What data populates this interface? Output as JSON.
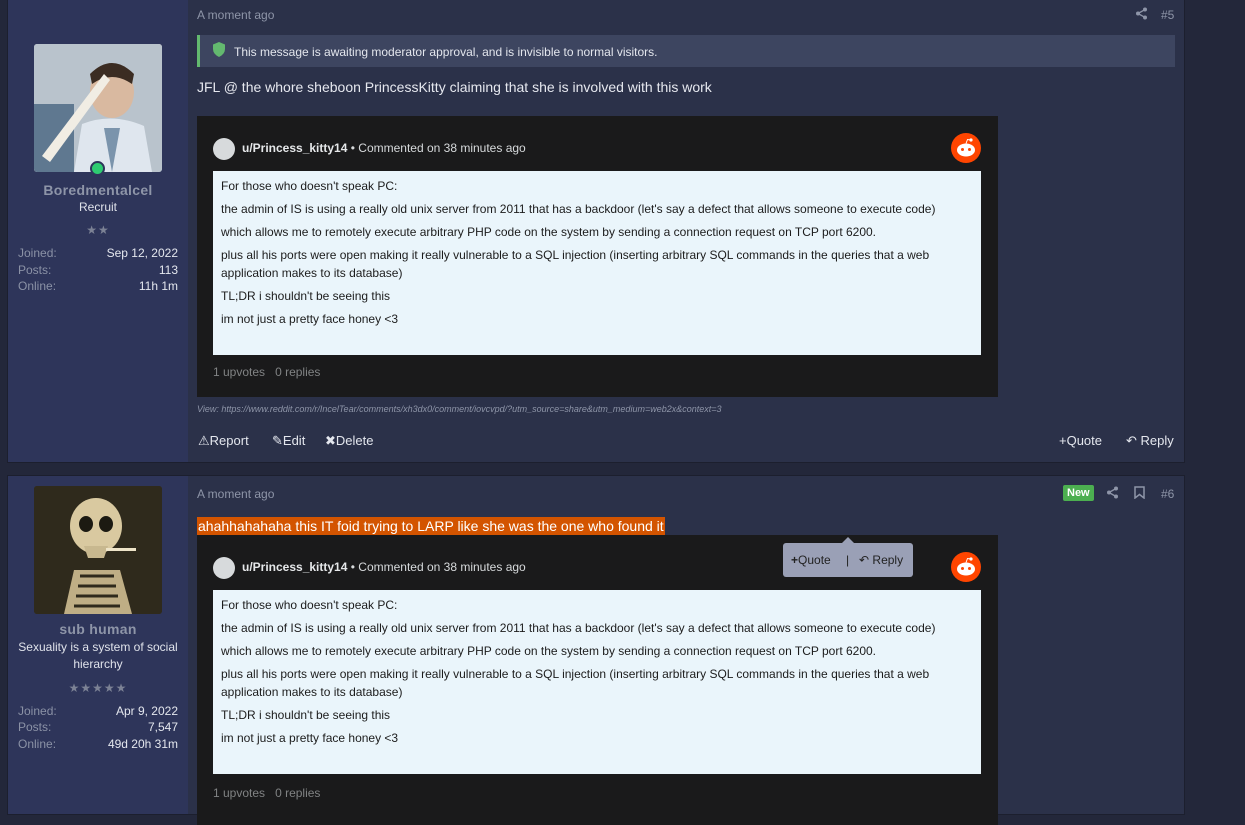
{
  "posts": [
    {
      "time": "A moment ago",
      "number": "#5",
      "user": {
        "name": "Boredmentalcel",
        "title": "Recruit",
        "stars": "★★",
        "joined_label": "Joined:",
        "joined": "Sep 12, 2022",
        "posts_label": "Posts:",
        "posts": "113",
        "online_label": "Online:",
        "online": "11h 1m"
      },
      "notice": "This message is awaiting moderator approval, and is invisible to normal visitors.",
      "message": "JFL @ the whore sheboon PrincessKitty claiming that she is involved with this work",
      "embed": {
        "author": "u/Princess_kitty14",
        "commented": "Commented on 38 minutes ago",
        "lines": [
          "For those who doesn't speak PC:",
          "the admin of IS is using a really old unix server from 2011 that has a backdoor (let's say a defect that allows someone to execute code)",
          "which allows me to remotely execute arbitrary PHP code on the system by sending a connection request on TCP port 6200.",
          "plus all his ports were open making it really vulnerable to a SQL injection (inserting arbitrary SQL commands in the queries that a web application makes to its database)",
          "TL;DR i shouldn't be seeing this",
          "im not just a pretty face honey <3"
        ],
        "upvotes": "1 upvotes",
        "replies": "0 replies"
      },
      "view_link": "View: https://www.reddit.com/r/IncelTear/comments/xh3dx0/comment/iovcvpd/?utm_source=share&utm_medium=web2x&context=3",
      "actions": {
        "report": "Report",
        "edit": "Edit",
        "delete": "Delete",
        "quote": "Quote",
        "reply": "Reply"
      }
    },
    {
      "time": "A moment ago",
      "number": "#6",
      "badge": "New",
      "user": {
        "name": "sub human",
        "title": "Sexuality is a system of social hierarchy",
        "stars": "★★★★★",
        "joined_label": "Joined:",
        "joined": "Apr 9, 2022",
        "posts_label": "Posts:",
        "posts": "7,547",
        "online_label": "Online:",
        "online": "49d 20h 31m"
      },
      "message": "ahahhahahaha this IT foid trying to LARP like she was the one who found it",
      "popup": {
        "quote": "Quote",
        "sep": "|",
        "reply": "Reply"
      },
      "embed": {
        "author": "u/Princess_kitty14",
        "commented": "Commented on 38 minutes ago",
        "lines": [
          "For those who doesn't speak PC:",
          "the admin of IS is using a really old unix server from 2011 that has a backdoor (let's say a defect that allows someone to execute code)",
          "which allows me to remotely execute arbitrary PHP code on the system by sending a connection request on TCP port 6200.",
          "plus all his ports were open making it really vulnerable to a SQL injection (inserting arbitrary SQL commands in the queries that a web application makes to its database)",
          "TL;DR i shouldn't be seeing this",
          "im not just a pretty face honey <3"
        ],
        "upvotes": "1 upvotes",
        "replies": "0 replies"
      }
    }
  ]
}
